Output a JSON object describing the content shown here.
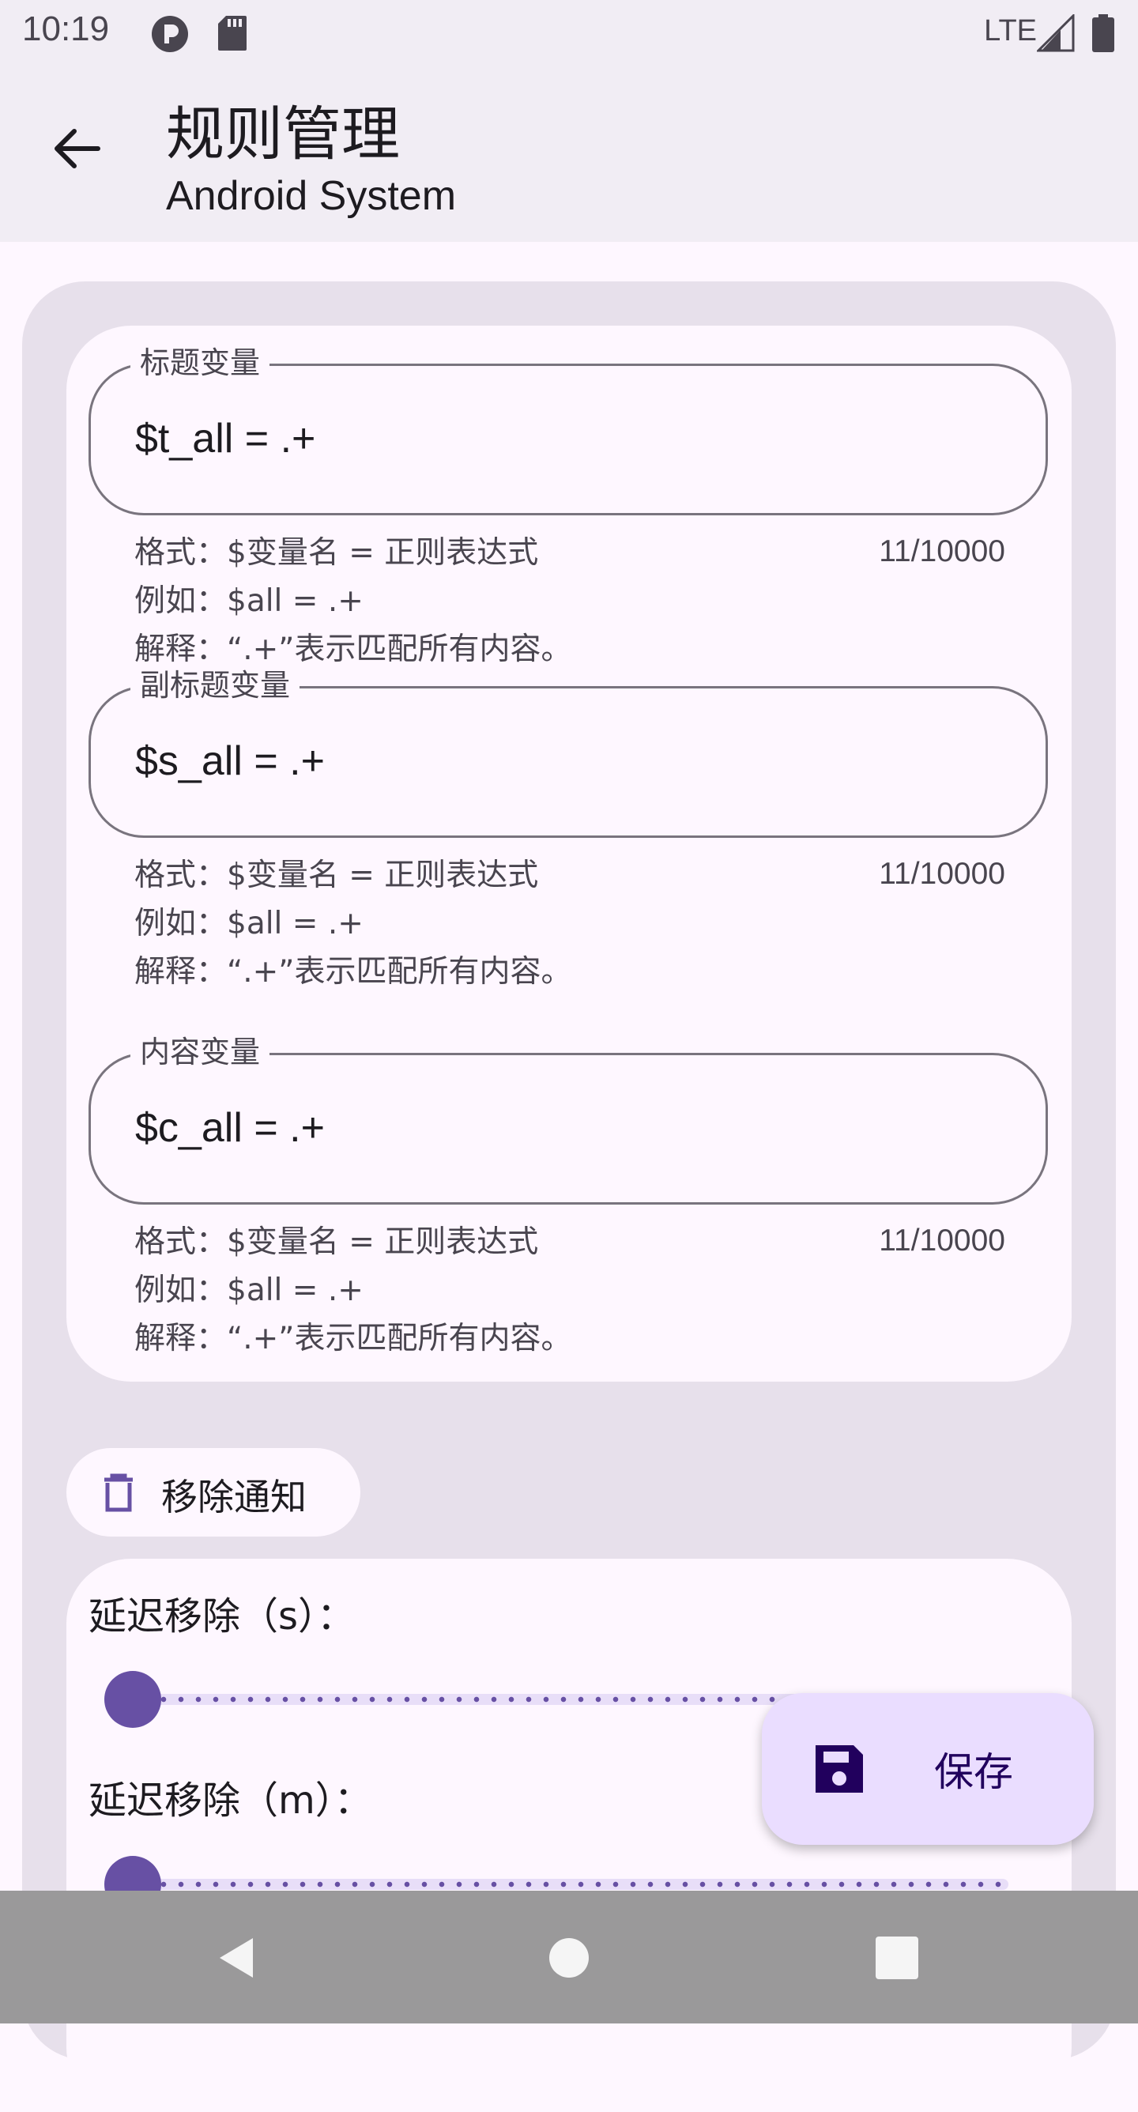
{
  "status_bar": {
    "time": "10:19",
    "network": "LTE"
  },
  "app_bar": {
    "title": "规则管理",
    "subtitle": "Android System"
  },
  "fields": [
    {
      "label": "标题变量",
      "value": "$t_all = .+",
      "help_format": "格式：$变量名 = 正则表达式",
      "help_example": "例如：$all = .+",
      "help_explain": "解释：“.+”表示匹配所有内容。",
      "counter": "11/10000"
    },
    {
      "label": "副标题变量",
      "value": "$s_all = .+",
      "help_format": "格式：$变量名 = 正则表达式",
      "help_example": "例如：$all = .+",
      "help_explain": "解释：“.+”表示匹配所有内容。",
      "counter": "11/10000"
    },
    {
      "label": "内容变量",
      "value": "$c_all = .+",
      "help_format": "格式：$变量名 = 正则表达式",
      "help_example": "例如：$all = .+",
      "help_explain": "解释：“.+”表示匹配所有内容。",
      "counter": "11/10000"
    }
  ],
  "remove_chip": {
    "label": "移除通知",
    "icon": "trash-icon"
  },
  "delay": {
    "seconds_label": "延迟移除（s）：",
    "minutes_label": "延迟移除（m）：",
    "seconds_value": 0,
    "minutes_value": 0
  },
  "fab": {
    "label": "保存",
    "icon": "save-icon"
  },
  "colors": {
    "primary": "#6750A4",
    "surface": "#FEF7FF",
    "surface_container": "#E7E0EB",
    "fab_container": "#EADDFF"
  }
}
